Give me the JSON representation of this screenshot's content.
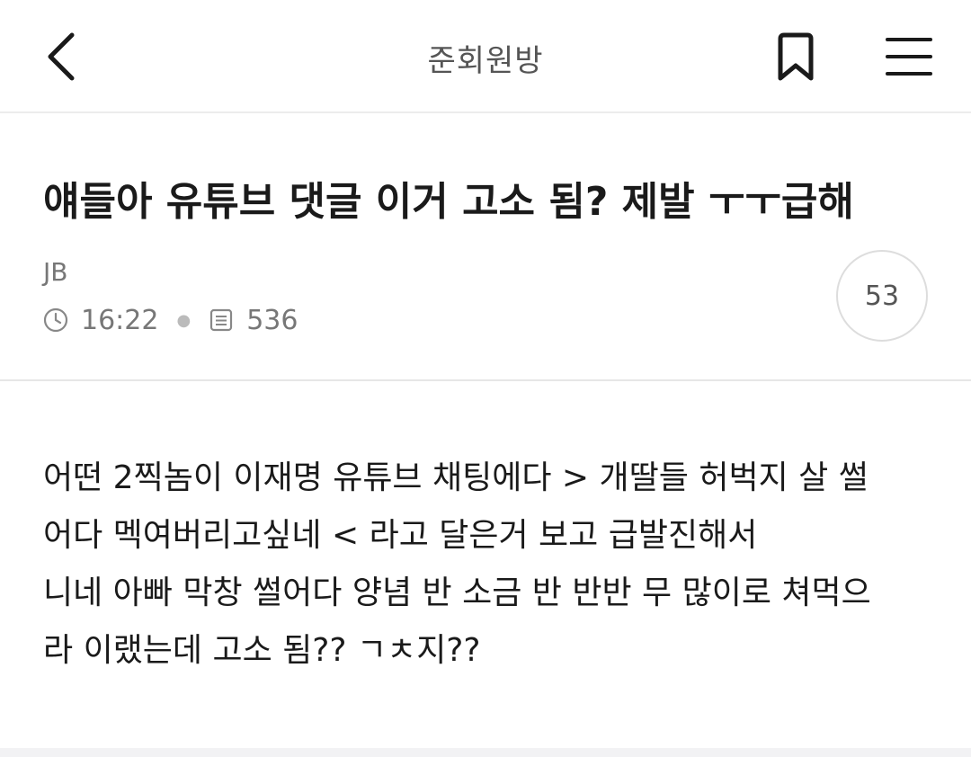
{
  "header": {
    "board_title": "준회원방",
    "back_icon": "chevron-left-icon",
    "bookmark_icon": "bookmark-icon",
    "menu_icon": "hamburger-menu-icon"
  },
  "post": {
    "title": "얘들아 유튜브 댓글 이거 고소 됨? 제발 ㅜㅜ급해",
    "author": "JB",
    "time": "16:22",
    "views": "536",
    "comment_count": "53",
    "body_lines": [
      "어떤 2찍놈이 이재명 유튜브 채팅에다 > 개딸들 허벅지 살 썰",
      "어다 멕여버리고싶네 < 라고 달은거 보고 급발진해서",
      "니네 아빠 막창 썰어다 양념 반 소금 반 반반 무 많이로 쳐먹으",
      "라 이랬는데 고소 됨?? ㄱㅊ지??"
    ]
  }
}
